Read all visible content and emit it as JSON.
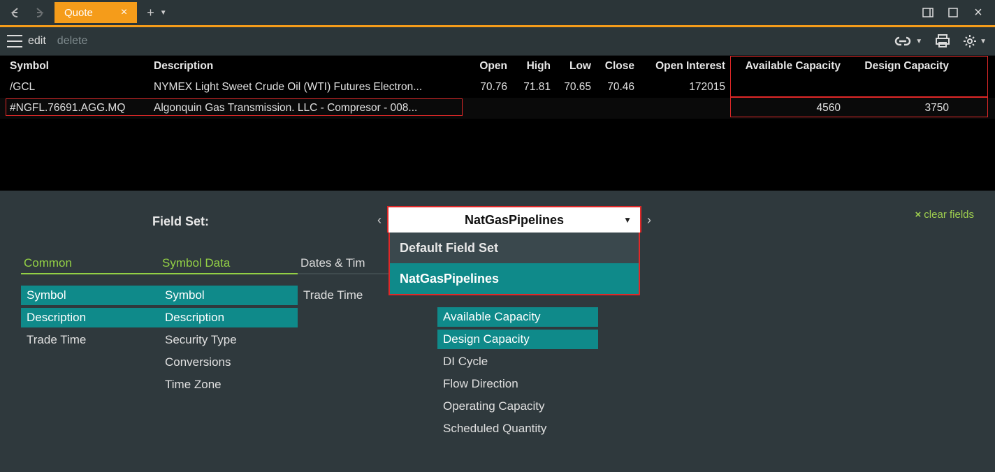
{
  "titlebar": {
    "tabLabel": "Quote"
  },
  "toolbar": {
    "edit": "edit",
    "delete": "delete"
  },
  "grid": {
    "headers": {
      "symbol": "Symbol",
      "description": "Description",
      "open": "Open",
      "high": "High",
      "low": "Low",
      "close": "Close",
      "openInterest": "Open Interest",
      "availCap": "Available Capacity",
      "designCap": "Design Capacity"
    },
    "rows": [
      {
        "symbol": "/GCL",
        "description": "NYMEX Light Sweet Crude Oil (WTI) Futures Electron...",
        "open": "70.76",
        "high": "71.81",
        "low": "70.65",
        "close": "70.46",
        "openInterest": "172015",
        "availCap": "",
        "designCap": ""
      },
      {
        "symbol": "#NGFL.76691.AGG.MQ",
        "description": "Algonquin Gas Transmission. LLC - Compresor - 008...",
        "open": "",
        "high": "",
        "low": "",
        "close": "",
        "openInterest": "",
        "availCap": "4560",
        "designCap": "3750"
      }
    ]
  },
  "fieldpanel": {
    "label": "Field Set:",
    "selected": "NatGasPipelines",
    "options": [
      "Default Field Set",
      "NatGasPipelines"
    ],
    "clearFields": "clear fields",
    "columns": {
      "common": {
        "title": "Common",
        "items": [
          "Symbol",
          "Description",
          "Trade Time"
        ],
        "selectedIdx": [
          0,
          1
        ]
      },
      "symbolData": {
        "title": "Symbol Data",
        "items": [
          "Symbol",
          "Description",
          "Security Type",
          "Conversions",
          "Time Zone"
        ],
        "selectedIdx": [
          0,
          1
        ]
      },
      "datesTimes": {
        "title": "Dates & Tim",
        "items": [
          "Trade Time"
        ],
        "selectedIdx": []
      },
      "pipeline": {
        "title": "",
        "items": [
          "Available Capacity",
          "Design Capacity",
          "DI Cycle",
          "Flow Direction",
          "Operating Capacity",
          "Scheduled Quantity"
        ],
        "selectedIdx": [
          0,
          1
        ]
      }
    }
  }
}
